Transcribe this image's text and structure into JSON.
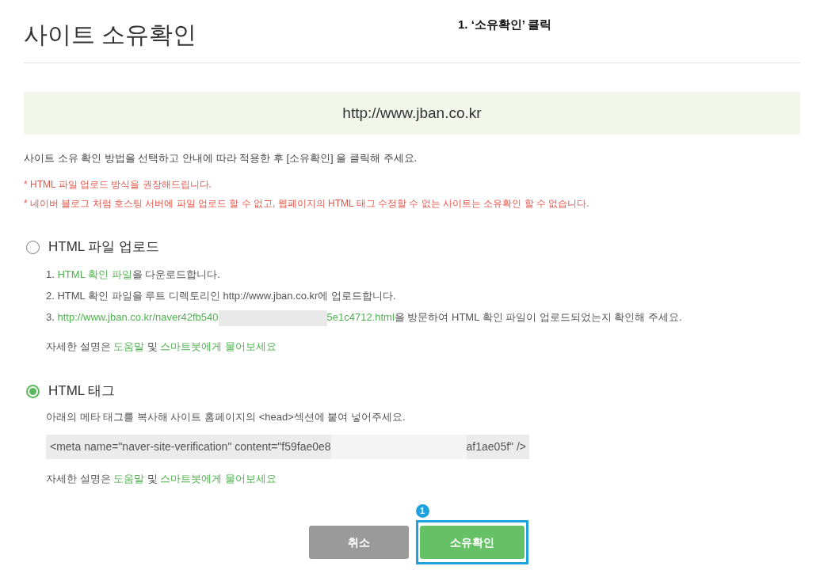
{
  "page": {
    "title": "사이트 소유확인"
  },
  "annotation": {
    "label": "1. ‘소유확인’ 클릭"
  },
  "site_url": "http://www.jban.co.kr",
  "instruction": "사이트 소유 확인 방법을 선택하고 안내에 따라 적용한 후 [소유확인] 을 클릭해 주세요.",
  "notes": [
    "* HTML 파일 업로드 방식을 권장해드립니다.",
    "* 네이버 블로그 처럼 호스팅 서버에 파일 업로드 할 수 없고, 웹페이지의 HTML 태그 수정할 수 없는 사이트는 소유확인 할 수 없습니다."
  ],
  "methods": [
    {
      "kind": "file_upload",
      "label": "HTML 파일 업로드",
      "selected": false,
      "steps": [
        [
          {
            "kind": "text",
            "text": "1. "
          },
          {
            "kind": "link",
            "text": "HTML 확인 파일"
          },
          {
            "kind": "text",
            "text": "을 다운로드합니다."
          }
        ],
        [
          {
            "kind": "text",
            "text": "2. HTML 확인 파일을 루트 디렉토리인 http://www.jban.co.kr에 업로드합니다."
          }
        ],
        [
          {
            "kind": "text",
            "text": "3. "
          },
          {
            "kind": "link",
            "text": "http://www.jban.co.kr/naver42fb540"
          },
          {
            "kind": "redacted"
          },
          {
            "kind": "link",
            "text": "5e1c4712.html"
          },
          {
            "kind": "text",
            "text": "을 방문하여 HTML 확인 파일이 업로드되었는지 확인해 주세요."
          }
        ]
      ],
      "help": {
        "prefix": "자세한 설명은 ",
        "help_link": "도움말",
        "joiner": " 및 ",
        "bot_link": "스마트봇에게 물어보세요"
      }
    },
    {
      "kind": "meta_tag",
      "label": "HTML 태그",
      "selected": true,
      "description": "아래의 메타 태그를 복사해 사이트 홈페이지의 <head>섹션에 붙여 넣어주세요.",
      "code": [
        {
          "kind": "text",
          "text": "<meta name=\"naver-site-verification\" content=\"f59fae0e8"
        },
        {
          "kind": "redacted"
        },
        {
          "kind": "text",
          "text": "af1ae05f\" />"
        }
      ],
      "help": {
        "prefix": "자세한 설명은 ",
        "help_link": "도움말",
        "joiner": " 및 ",
        "bot_link": "스마트봇에게 물어보세요"
      }
    }
  ],
  "buttons": [
    {
      "kind": "cancel",
      "label": "취소"
    },
    {
      "kind": "confirm",
      "label": "소유확인",
      "highlighted": true,
      "badge": "1"
    }
  ]
}
